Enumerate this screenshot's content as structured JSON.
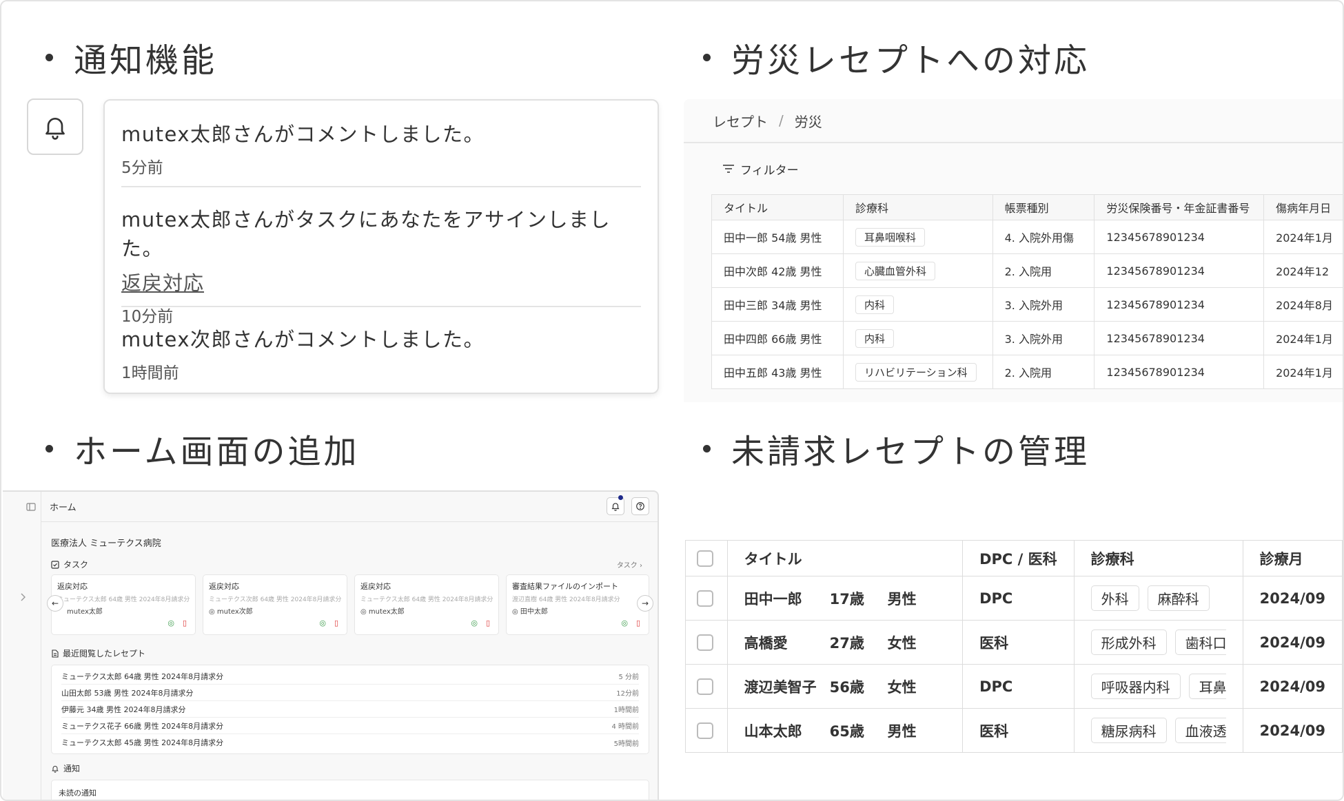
{
  "sections": {
    "notifications": "通知機能",
    "rosai": "労災レセプトへの対応",
    "home": "ホーム画面の追加",
    "unbilled": "未請求レセプトの管理"
  },
  "notifications": [
    {
      "text": "mutex太郎さんがコメントしました。",
      "link": "",
      "time": "5分前"
    },
    {
      "text": "mutex太郎さんがタスクにあなたをアサインしました。",
      "link": "返戻対応",
      "time": "10分前"
    },
    {
      "text": "mutex次郎さんがコメントしました。",
      "link": "",
      "time": "1時間前"
    }
  ],
  "rosai": {
    "breadcrumb": [
      "レセプト",
      "労災"
    ],
    "filter_label": "フィルター",
    "columns": [
      "タイトル",
      "診療科",
      "帳票種別",
      "労災保険番号・年金証書番号",
      "傷病年月日"
    ],
    "rows": [
      {
        "title": "田中一郎 54歳 男性",
        "dept": "耳鼻咽喉科",
        "form": "4. 入院外用傷",
        "number": "12345678901234",
        "date": "2024年1月"
      },
      {
        "title": "田中次郎 42歳 男性",
        "dept": "心臓血管外科",
        "form": "2. 入院用",
        "number": "12345678901234",
        "date": "2024年12"
      },
      {
        "title": "田中三郎 34歳 男性",
        "dept": "内科",
        "form": "3. 入院外用",
        "number": "12345678901234",
        "date": "2024年8月"
      },
      {
        "title": "田中四郎 66歳 男性",
        "dept": "内科",
        "form": "3. 入院外用",
        "number": "12345678901234",
        "date": "2024年1月"
      },
      {
        "title": "田中五郎 43歳 男性",
        "dept": "リハビリテーション科",
        "form": "2. 入院用",
        "number": "12345678901234",
        "date": "2024年1月"
      }
    ]
  },
  "home": {
    "title": "ホーム",
    "org": "医療法人 ミューテクス病院",
    "tasks_label": "タスク",
    "tasks_link": "タスク",
    "tasks": [
      {
        "title": "返戻対応",
        "sub": "ミューテクス太郎 64歳 男性 2024年8月請求分",
        "user": "mutex太郎"
      },
      {
        "title": "返戻対応",
        "sub": "ミューテクス次郎 64歳 男性 2024年8月請求分",
        "user": "mutex次郎"
      },
      {
        "title": "返戻対応",
        "sub": "ミューテクス太郎 64歳 男性 2024年8月請求分",
        "user": "mutex太郎"
      },
      {
        "title": "審査結果ファイルのインポート",
        "sub": "渡辺直樹 64歳 男性 2024年8月請求分",
        "user": "田中太郎"
      }
    ],
    "recent_label": "最近閲覧したレセプト",
    "recent": [
      {
        "name": "ミューテクス太郎 64歳 男性 2024年8月請求分",
        "time": "5 分前"
      },
      {
        "name": "山田太郎 53歳 男性 2024年8月請求分",
        "time": "12分前"
      },
      {
        "name": "伊藤元 34歳 男性 2024年8月請求分",
        "time": "1時間前"
      },
      {
        "name": "ミューテクス花子 66歳 男性 2024年8月請求分",
        "time": "4 時間前"
      },
      {
        "name": "ミューテクス太郎 45歳 男性 2024年8月請求分",
        "time": "5時間前"
      }
    ],
    "notify_label": "通知",
    "unread_label": "未読の通知"
  },
  "unbilled": {
    "columns": [
      "タイトル",
      "DPC / 医科",
      "診療科",
      "診療月"
    ],
    "rows": [
      {
        "name": "田中一郎",
        "age": "17歳",
        "sex": "男性",
        "type": "DPC",
        "depts": [
          "外科",
          "麻酔科"
        ],
        "month": "2024/09"
      },
      {
        "name": "高橋愛",
        "age": "27歳",
        "sex": "女性",
        "type": "医科",
        "depts": [
          "形成外科",
          "歯科口"
        ],
        "month": "2024/09"
      },
      {
        "name": "渡辺美智子",
        "age": "56歳",
        "sex": "女性",
        "type": "DPC",
        "depts": [
          "呼吸器内科",
          "耳鼻"
        ],
        "month": "2024/09"
      },
      {
        "name": "山本太郎",
        "age": "65歳",
        "sex": "男性",
        "type": "医科",
        "depts": [
          "糖尿病科",
          "血液透"
        ],
        "month": "2024/09"
      }
    ]
  }
}
